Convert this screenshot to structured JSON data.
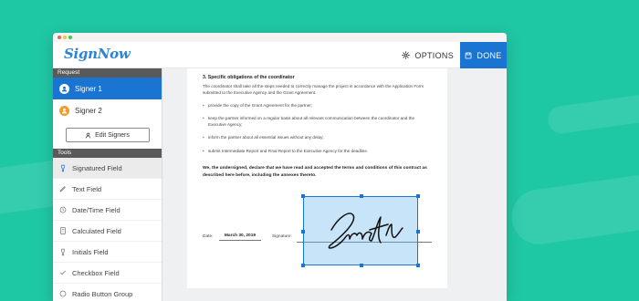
{
  "app": {
    "logo": "SignNow"
  },
  "header": {
    "options_label": "OPTIONS",
    "done_label": "DONE"
  },
  "sidebar": {
    "request_label": "Request",
    "signers": [
      {
        "label": "Signer 1",
        "color": "#ffffff"
      },
      {
        "label": "Signer 2",
        "color": "#f29b28"
      }
    ],
    "edit_signers_label": "Edit Signers",
    "tools_label": "Tools",
    "tools": [
      {
        "label": "Signatured Field",
        "icon": "pen-nib-icon"
      },
      {
        "label": "Text Field",
        "icon": "pencil-icon"
      },
      {
        "label": "Date/Time Field",
        "icon": "clock-icon"
      },
      {
        "label": "Calculated Field",
        "icon": "calculator-icon"
      },
      {
        "label": "Initials Field",
        "icon": "pen-nib-icon"
      },
      {
        "label": "Checkbox Field",
        "icon": "checkmark-icon"
      },
      {
        "label": "Radio Button Group",
        "icon": "radio-icon"
      }
    ]
  },
  "document": {
    "heading": "3. Specific obligations of the coordinator",
    "paragraph": "The coordinator shall take all the steps needed to correctly manage the project in accordance with the Application Form submitted to the Executive Agency and the Grant Agreement.",
    "bullets": [
      "provide the copy of the Grant Agreement for the partner;",
      "keep the partner informed on a regular basis about all relevant communication between the coordinator and the Executive Agency;",
      "inform the partner about all essential issues without any delay;",
      "submit Intermediate Report and Final Report to the Executive Agency for the deadline."
    ],
    "declaration": "We, the undersigned, declare that we have read and accepted the terms and conditions of this contract as described here before, including the annexes thereto.",
    "date_label": "Date:",
    "date_value": "March 30, 2019",
    "signature_label": "Signature:"
  },
  "colors": {
    "accent": "#1a74d2",
    "background": "#1fc8a5"
  }
}
